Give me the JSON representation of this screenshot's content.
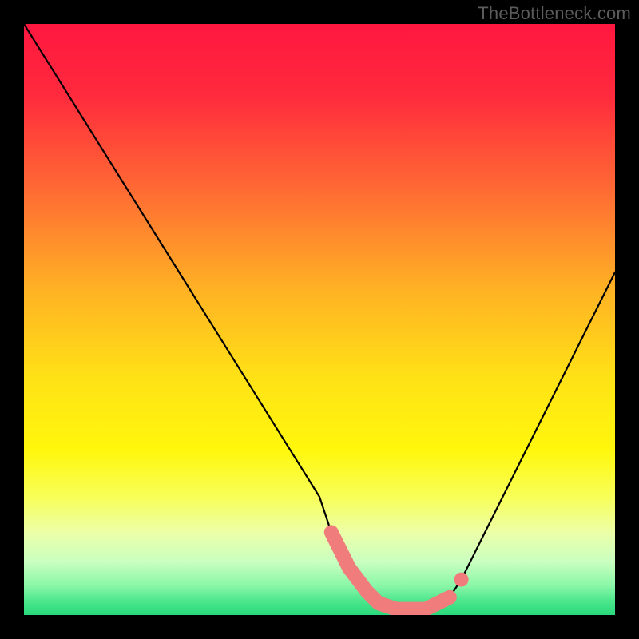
{
  "watermark": "TheBottleneck.com",
  "chart_data": {
    "type": "line",
    "title": "",
    "xlabel": "",
    "ylabel": "",
    "xlim": [
      0,
      100
    ],
    "ylim": [
      0,
      100
    ],
    "grid": false,
    "legend": false,
    "background": {
      "type": "vertical-gradient",
      "stops": [
        {
          "offset": 0.0,
          "color": "#ff173f"
        },
        {
          "offset": 0.12,
          "color": "#ff2a3d"
        },
        {
          "offset": 0.28,
          "color": "#ff6a34"
        },
        {
          "offset": 0.45,
          "color": "#ffb224"
        },
        {
          "offset": 0.6,
          "color": "#ffe216"
        },
        {
          "offset": 0.72,
          "color": "#fff70c"
        },
        {
          "offset": 0.8,
          "color": "#f8ff58"
        },
        {
          "offset": 0.86,
          "color": "#ecffa8"
        },
        {
          "offset": 0.91,
          "color": "#c9ffc0"
        },
        {
          "offset": 0.95,
          "color": "#8bf7a8"
        },
        {
          "offset": 0.975,
          "color": "#4fe78e"
        },
        {
          "offset": 1.0,
          "color": "#29d97b"
        }
      ]
    },
    "series": [
      {
        "name": "bottleneck-curve",
        "color": "#000000",
        "x": [
          0,
          5,
          10,
          15,
          20,
          25,
          30,
          35,
          40,
          45,
          50,
          52,
          55,
          58,
          60,
          63,
          65,
          68,
          70,
          72,
          74,
          76,
          80,
          85,
          90,
          95,
          100
        ],
        "y": [
          100,
          92,
          84,
          76,
          68,
          60,
          52,
          44,
          36,
          28,
          20,
          14,
          8,
          4,
          2,
          1,
          1,
          1,
          2,
          3,
          6,
          10,
          18,
          28,
          38,
          48,
          58
        ]
      }
    ],
    "highlight_segment": {
      "color": "#f07c7c",
      "x": [
        52,
        55,
        58,
        60,
        63,
        65,
        68,
        70,
        72
      ],
      "y": [
        14,
        8,
        4,
        2,
        1,
        1,
        1,
        2,
        3
      ]
    },
    "highlight_point": {
      "x": 74,
      "y": 6,
      "color": "#f07c7c"
    }
  }
}
